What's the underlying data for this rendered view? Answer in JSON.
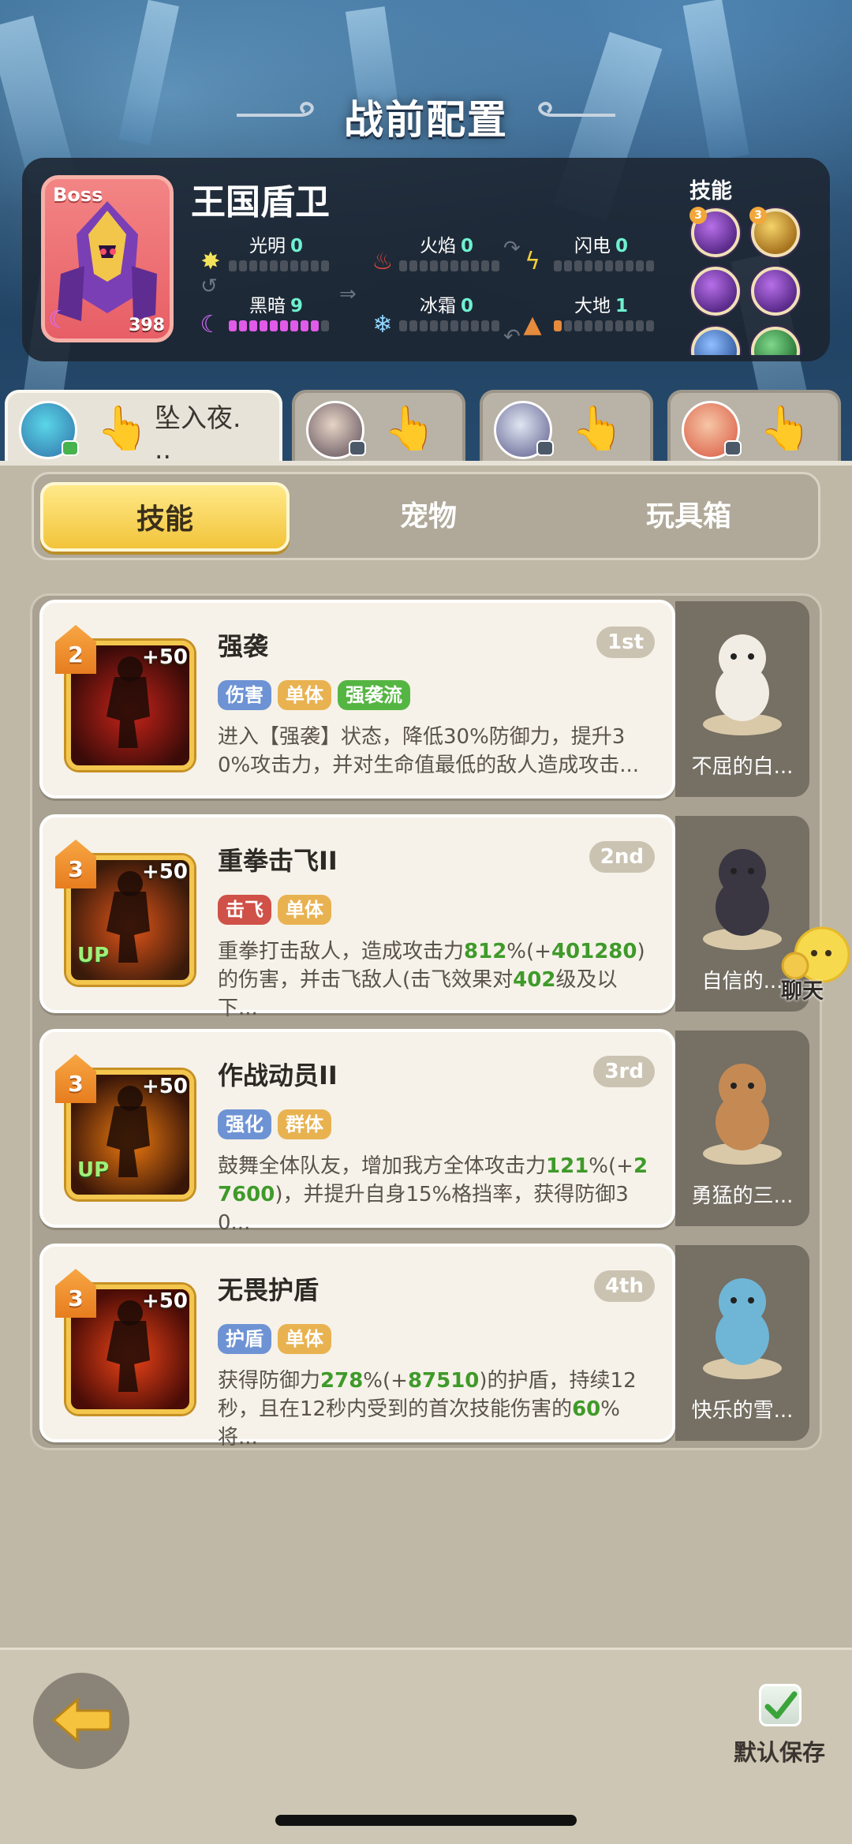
{
  "header": {
    "title": "战前配置"
  },
  "boss": {
    "label": "Boss",
    "name": "王国盾卫",
    "level": "398",
    "skills_label": "技能",
    "skill_orb_levels": [
      "3",
      "3"
    ],
    "elements": [
      {
        "key": "light",
        "label": "光明",
        "value": "0",
        "icon": "sun-icon"
      },
      {
        "key": "fire",
        "label": "火焰",
        "value": "0",
        "icon": "flame-icon"
      },
      {
        "key": "lightning",
        "label": "闪电",
        "value": "0",
        "icon": "lightning-icon"
      },
      {
        "key": "dark",
        "label": "黑暗",
        "value": "9",
        "icon": "moon-icon"
      },
      {
        "key": "frost",
        "label": "冰霜",
        "value": "0",
        "icon": "snowflake-icon"
      },
      {
        "key": "earth",
        "label": "大地",
        "value": "1",
        "icon": "mountain-icon"
      }
    ]
  },
  "heroes": [
    {
      "name": "坠入夜.\n..",
      "active": true
    },
    {
      "name": "",
      "active": false
    },
    {
      "name": "",
      "active": false
    },
    {
      "name": "",
      "active": false
    }
  ],
  "tabs": [
    {
      "label": "技能",
      "active": true
    },
    {
      "label": "宠物",
      "active": false
    },
    {
      "label": "玩具箱",
      "active": false
    }
  ],
  "skills": [
    {
      "level": "2",
      "plus": "+50",
      "up": false,
      "title": "强袭",
      "rank": "1st",
      "tags": [
        {
          "text": "伤害",
          "color": "blue"
        },
        {
          "text": "单体",
          "color": "orange"
        },
        {
          "text": "强袭流",
          "color": "green"
        }
      ],
      "desc_parts": [
        {
          "t": "进入【强袭】状态，降低30%防御力，提升30%攻击力，并对生命值最低的敌人造成攻击..."
        }
      ],
      "pet": "不屈的白..."
    },
    {
      "level": "3",
      "plus": "+50",
      "up": true,
      "up_label": "UP",
      "title": "重拳击飞II",
      "rank": "2nd",
      "tags": [
        {
          "text": "击飞",
          "color": "red"
        },
        {
          "text": "单体",
          "color": "orange"
        }
      ],
      "desc_parts": [
        {
          "t": "重拳打击敌人，造成攻击力"
        },
        {
          "t": "812",
          "hl": true
        },
        {
          "t": "%(+"
        },
        {
          "t": "401280",
          "hl": true
        },
        {
          "t": ")的伤害，并击飞敌人(击飞效果对"
        },
        {
          "t": "402",
          "hl": true
        },
        {
          "t": "级及以下..."
        }
      ],
      "pet": "自信的..."
    },
    {
      "level": "3",
      "plus": "+50",
      "up": true,
      "up_label": "UP",
      "title": "作战动员II",
      "rank": "3rd",
      "tags": [
        {
          "text": "强化",
          "color": "blue"
        },
        {
          "text": "群体",
          "color": "orange"
        }
      ],
      "desc_parts": [
        {
          "t": "鼓舞全体队友，增加我方全体攻击力"
        },
        {
          "t": "121",
          "hl": true
        },
        {
          "t": "%(+"
        },
        {
          "t": "27600",
          "hl": true
        },
        {
          "t": ")，并提升自身15%格挡率，获得防御30..."
        }
      ],
      "pet": "勇猛的三..."
    },
    {
      "level": "3",
      "plus": "+50",
      "up": false,
      "title": "无畏护盾",
      "rank": "4th",
      "tags": [
        {
          "text": "护盾",
          "color": "blue"
        },
        {
          "text": "单体",
          "color": "orange"
        }
      ],
      "desc_parts": [
        {
          "t": "获得防御力"
        },
        {
          "t": "278",
          "hl": true
        },
        {
          "t": "%(+"
        },
        {
          "t": "87510",
          "hl": true
        },
        {
          "t": ")的护盾，持续12秒，且在12秒内受到的首次技能伤害的"
        },
        {
          "t": "60",
          "hl": true
        },
        {
          "t": "%将..."
        }
      ],
      "pet": "快乐的雪..."
    }
  ],
  "chat": {
    "label": "聊天"
  },
  "footer": {
    "save_label": "默认保存"
  },
  "colors": {
    "accent": "#f2c43a",
    "highlight_green": "#3f9a2a",
    "dark_bar": "#e05be8"
  }
}
